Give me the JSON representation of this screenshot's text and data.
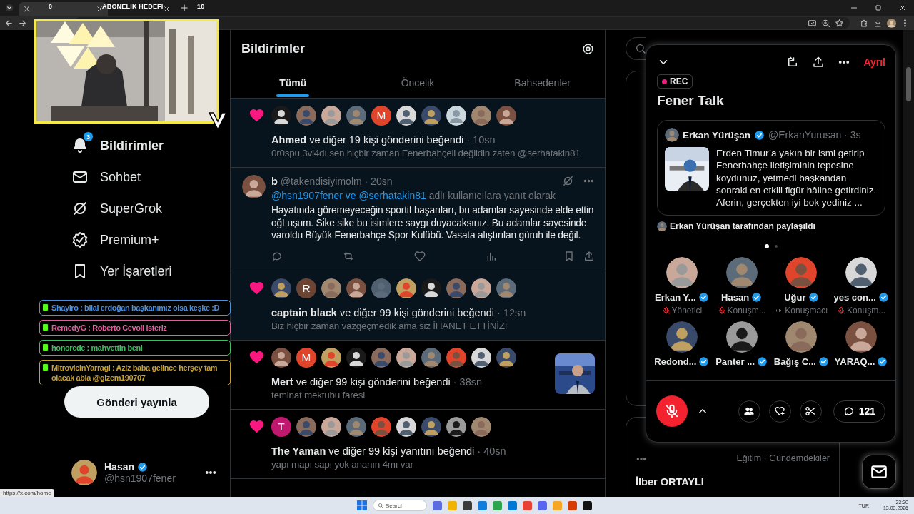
{
  "browser": {
    "tabs": [
      {
        "selected": true
      },
      {
        "selected": false
      }
    ],
    "status_url": "https://x.com/home"
  },
  "stream_overlay": {
    "goal_current": "0",
    "goal_label": "ABONELIK HEDEFI",
    "goal_target": "10"
  },
  "sidebar": {
    "items": [
      {
        "kind": "bell",
        "label": "Bildirimler",
        "selected": true,
        "badge": "3"
      },
      {
        "kind": "mail",
        "label": "Sohbet",
        "selected": false
      },
      {
        "kind": "grok",
        "label": "SuperGrok",
        "selected": false
      },
      {
        "kind": "premium",
        "label": "Premium+",
        "selected": false
      },
      {
        "kind": "bookmark",
        "label": "Yer İşaretleri",
        "selected": false
      }
    ],
    "post_button": "Gönderi yayınla",
    "profile": {
      "name": "Hasan",
      "verified": true,
      "handle": "@hsn1907fener"
    }
  },
  "chat_overlay": [
    {
      "text": "Shayiro : bilal erdoğan başkanımız olsa keşke :D",
      "color": "#4a8fe0"
    },
    {
      "text": "RemedyG : Roberto Cevoli isteriz",
      "color": "#e0609a"
    },
    {
      "text": "honorede : mahvettin beni",
      "color": "#3cc060"
    },
    {
      "text": "MitrovicinYarragi : Aziz baba gelince herşey tam olacak abla @gizem190707",
      "color": "#c8a030"
    }
  ],
  "header": {
    "title": "Bildirimler"
  },
  "tabs": [
    {
      "label": "Tümü",
      "selected": true
    },
    {
      "label": "Öncelik",
      "selected": false
    },
    {
      "label": "Bahsedenler",
      "selected": false
    }
  ],
  "notifications": [
    {
      "kind": "like",
      "unread": true,
      "summary": "**Ahmed** ve diğer 19 kişi gönderini beğendi",
      "time": "· 10sn",
      "snippet": "0r0spu 3vl4dı sen hiçbir zaman Fenerbahçeli değildin zaten @serhatakin81",
      "avatars": [
        {
          "kind": "picture"
        },
        {
          "kind": "picture"
        },
        {
          "kind": "picture"
        },
        {
          "kind": "picture"
        },
        {
          "kind": "letter",
          "letter": "M",
          "color": "#e0452c"
        },
        {
          "kind": "picture"
        },
        {
          "kind": "picture"
        },
        {
          "kind": "default"
        },
        {
          "kind": "picture"
        },
        {
          "kind": "picture"
        }
      ]
    },
    {
      "kind": "reply",
      "unread": true,
      "author": "b",
      "handle": "@takendisiyimolm · 20sn",
      "reply_to": "@hsn1907fener ve @serhatakin81",
      "reply_suffix": "adlı kullanıcılara yanıt olarak",
      "text": "Hayatında göremeyeceğin sportif başarıları, bu adamlar sayesinde elde ettin oğLuşum. Sike sike bu isimlere saygı duyacaksınız. Bu adamlar sayesinde varoldu Büyük Fenerbahçe Spor Kulübü. Vasata alıştırılan güruh ile değil."
    },
    {
      "kind": "like",
      "unread": true,
      "summary": "**captain black** ve diğer 99 kişi gönderini beğendi",
      "time": "· 12sn",
      "snippet": "Biz hiçbir zaman vazgeçmedik ama siz İHANET ETTİNİZ!",
      "avatars": [
        {
          "kind": "picture"
        },
        {
          "kind": "letter",
          "letter": "R",
          "color": "#6b4433"
        },
        {
          "kind": "picture"
        },
        {
          "kind": "picture"
        },
        {
          "kind": "picture"
        },
        {
          "kind": "picture"
        },
        {
          "kind": "picture"
        },
        {
          "kind": "picture"
        },
        {
          "kind": "picture"
        },
        {
          "kind": "picture"
        }
      ]
    },
    {
      "kind": "like",
      "unread": false,
      "summary": "**Mert** ve diğer 99 kişi gönderini beğendi",
      "time": "· 38sn",
      "snippet": "teminat mektubu faresi",
      "thumbnail": {
        "kind": "picture"
      },
      "avatars": [
        {
          "kind": "picture"
        },
        {
          "kind": "letter",
          "letter": "M",
          "color": "#e0452c"
        },
        {
          "kind": "picture"
        },
        {
          "kind": "picture"
        },
        {
          "kind": "picture"
        },
        {
          "kind": "picture"
        },
        {
          "kind": "picture"
        },
        {
          "kind": "picture"
        },
        {
          "kind": "picture"
        },
        {
          "kind": "picture"
        }
      ]
    },
    {
      "kind": "like",
      "unread": false,
      "summary": "**The Yaman** ve diğer 99 kişi yanıtını beğendi",
      "time": "· 40sn",
      "snippet": "yapı mapı sapı yok ananın 4mı var",
      "avatars": [
        {
          "kind": "letter",
          "letter": "T",
          "color": "#c0186f"
        },
        {
          "kind": "picture"
        },
        {
          "kind": "picture"
        },
        {
          "kind": "picture"
        },
        {
          "kind": "picture"
        },
        {
          "kind": "picture"
        },
        {
          "kind": "picture"
        },
        {
          "kind": "picture"
        },
        {
          "kind": "picture"
        }
      ]
    }
  ],
  "trend": {
    "category": "Eğitim · Gündemdekiler",
    "title": "İlber ORTAYLI"
  },
  "space": {
    "leave": "Ayrıl",
    "rec": "REC",
    "title": "Fener Talk",
    "pinned": {
      "name": "Erkan Yürüşan",
      "verified": true,
      "handle": "@ErkanYurusan · 3s",
      "text": "Erden Timur’a yakın bir ismi getirip Fenerbahçe iletişiminin tepesine koydunuz, yetmedi başkandan sonraki en etkili figür hâline getirdiniz. Aferin, gerçekten iyi bok yediniz ..."
    },
    "shared_by": "Erkan Yürüşan tarafından paylaşıldı",
    "pages": [
      {
        "selected": true
      },
      {
        "selected": false
      }
    ],
    "participants": [
      {
        "name": "Erkan Y...",
        "verified": true,
        "muted": true,
        "role": "Yönetici"
      },
      {
        "name": "Hasan",
        "verified": true,
        "muted": true,
        "role": "Konuşm..."
      },
      {
        "name": "Uğur",
        "verified": true,
        "muted": false,
        "role": "Konuşmacı"
      },
      {
        "name": "yes con...",
        "verified": true,
        "muted": true,
        "role": "Konuşm..."
      },
      {
        "name": "Redond...",
        "verified": true
      },
      {
        "name": "Panter ...",
        "verified": true
      },
      {
        "name": "Bağış C...",
        "verified": true
      },
      {
        "name": "YARAQ...",
        "verified": true
      }
    ],
    "comments": "121"
  },
  "taskbar": {
    "search": "Search",
    "lang": "TUR",
    "time": "23:20",
    "date": "13.03.2026"
  }
}
